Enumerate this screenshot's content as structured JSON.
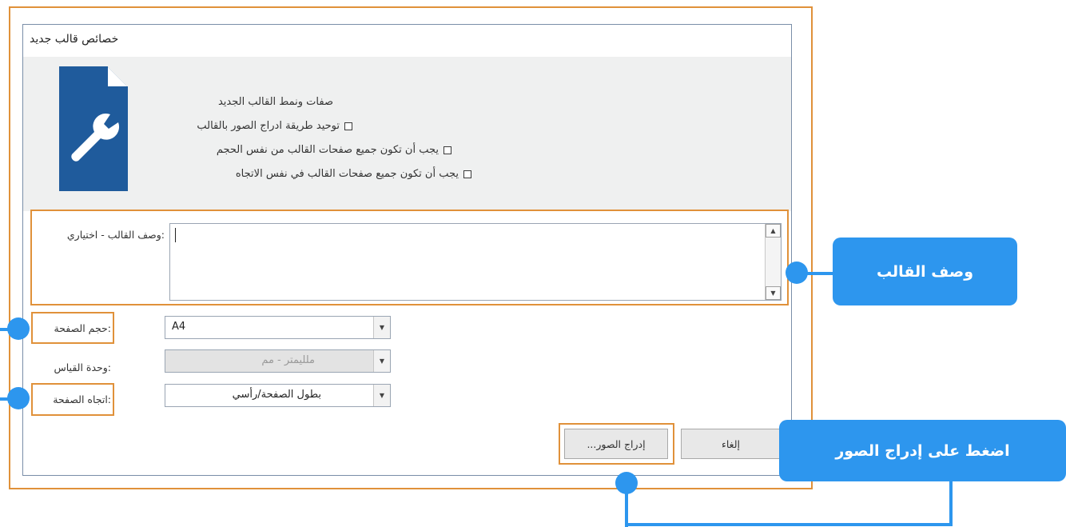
{
  "dialog": {
    "title": "خصائص قالب جديد",
    "header": {
      "section_heading": "صفات ونمط القالب الجديد",
      "options": [
        {
          "label": "توحيد طريقة ادراج الصور بالقالب",
          "checked": false
        },
        {
          "label": "يجب أن تكون جميع صفحات القالب من نفس الحجم",
          "checked": false
        },
        {
          "label": "يجب أن تكون جميع صفحات القالب في نفس الاتجاه",
          "checked": false
        }
      ]
    },
    "description": {
      "label": ":وصف القالب - اختياري",
      "value": ""
    },
    "page_size": {
      "label": ":حجم الصفحة",
      "value": "A4"
    },
    "unit": {
      "label": ":وحدة القياس",
      "value": "مللیمتر - مم"
    },
    "orientation": {
      "label": ":اتجاه الصفحة",
      "value": "بطول الصفحة/رأسي"
    },
    "buttons": {
      "insert_images": "إدراج الصور...",
      "cancel": "إلغاء"
    }
  },
  "callouts": {
    "description": "وصف القالب",
    "insert_images": "اضغط على إدراج الصور"
  },
  "colors": {
    "highlight": "#e0913a",
    "callout": "#2d96ee",
    "icon": "#1f5b9c",
    "header_bg": "#eff0f0"
  },
  "icons": {
    "template": "document-wrench-icon",
    "scroll_up": "triangle-up-icon",
    "scroll_down": "triangle-down-icon",
    "dropdown": "chevron-down-icon",
    "checkbox": "checkbox-empty-icon"
  }
}
